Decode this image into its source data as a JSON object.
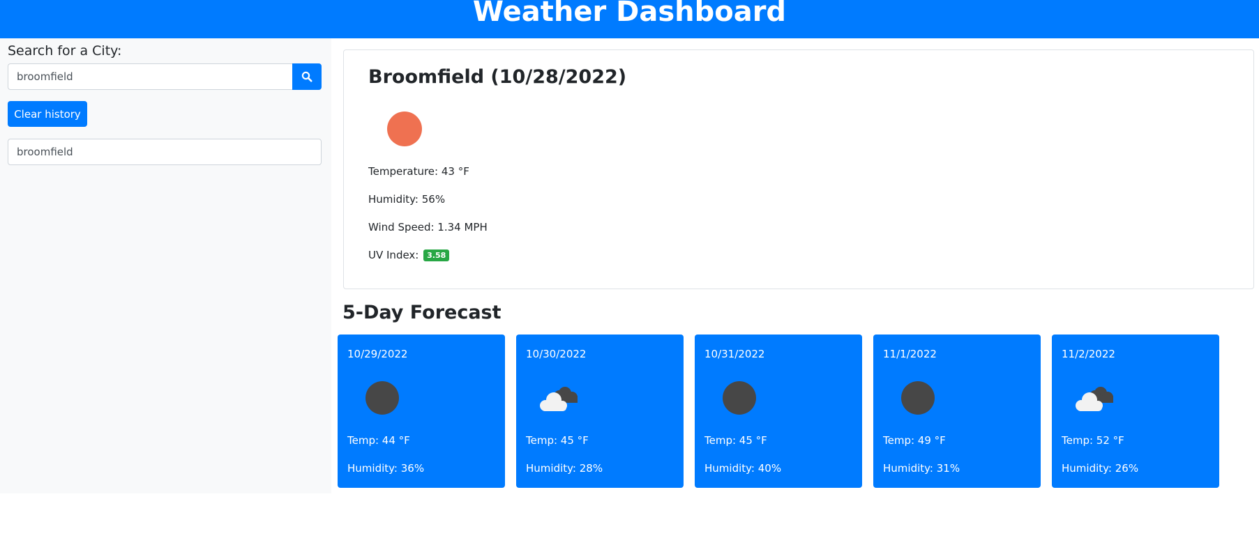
{
  "header": {
    "title": "Weather Dashboard"
  },
  "search": {
    "label": "Search for a City:",
    "value": "broomfield",
    "icon": "search-icon"
  },
  "clear_button": {
    "label": "Clear history"
  },
  "history": [
    {
      "label": "broomfield"
    }
  ],
  "current": {
    "title": "Broomfield (10/28/2022)",
    "icon": "sun-icon",
    "icon_color": "#ef7151",
    "temperature": "Temperature: 43 °F",
    "humidity": "Humidity: 56%",
    "wind": "Wind Speed: 1.34 MPH",
    "uv_label": "UV Index:",
    "uv_value": "3.58",
    "uv_color": "#28a745"
  },
  "forecast": {
    "title": "5-Day Forecast",
    "days": [
      {
        "date": "10/29/2022",
        "icon": "clear-night-icon",
        "temp": "Temp: 44 °F",
        "humidity": "Humidity: 36%"
      },
      {
        "date": "10/30/2022",
        "icon": "cloudy-icon",
        "temp": "Temp: 45 °F",
        "humidity": "Humidity: 28%"
      },
      {
        "date": "10/31/2022",
        "icon": "clear-night-icon",
        "temp": "Temp: 45 °F",
        "humidity": "Humidity: 40%"
      },
      {
        "date": "11/1/2022",
        "icon": "clear-night-icon",
        "temp": "Temp: 49 °F",
        "humidity": "Humidity: 31%"
      },
      {
        "date": "11/2/2022",
        "icon": "cloudy-icon",
        "temp": "Temp: 52 °F",
        "humidity": "Humidity: 26%"
      }
    ]
  },
  "colors": {
    "primary": "#007bff",
    "sidebar_bg": "#f8f9fa"
  }
}
